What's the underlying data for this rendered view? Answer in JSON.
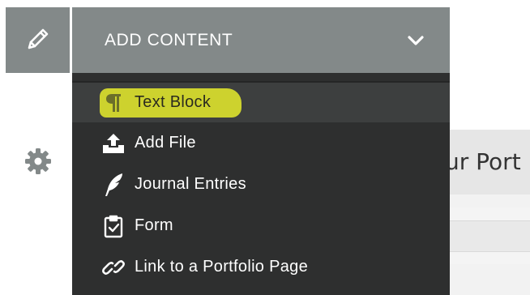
{
  "toolbar": {
    "edit_icon": "pencil-icon",
    "settings_icon": "gear-icon"
  },
  "background_page": {
    "title_fragment": "ur Port"
  },
  "add_content": {
    "label": "ADD CONTENT",
    "chevron_icon": "chevron-down-icon",
    "items": [
      {
        "label": "Text Block",
        "icon": "pilcrow-icon",
        "highlighted": true
      },
      {
        "label": "Add File",
        "icon": "upload-icon",
        "highlighted": false
      },
      {
        "label": "Journal Entries",
        "icon": "quill-icon",
        "highlighted": false
      },
      {
        "label": "Form",
        "icon": "clipboard-check-icon",
        "highlighted": false
      },
      {
        "label": "Link to a Portfolio Page",
        "icon": "link-icon",
        "highlighted": false
      }
    ]
  },
  "colors": {
    "header_gray": "#838989",
    "menu_dark": "#2e2f2f",
    "highlight": "#e6ec2b"
  }
}
